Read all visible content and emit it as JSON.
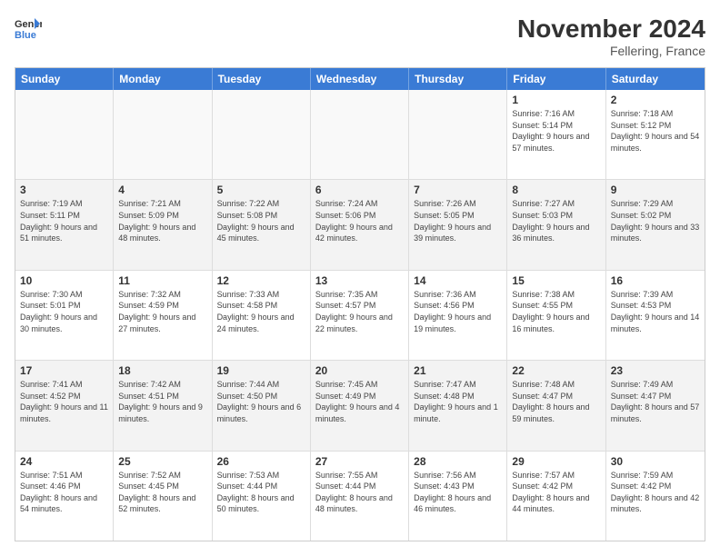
{
  "logo": {
    "line1": "General",
    "line2": "Blue"
  },
  "title": "November 2024",
  "location": "Fellering, France",
  "header_days": [
    "Sunday",
    "Monday",
    "Tuesday",
    "Wednesday",
    "Thursday",
    "Friday",
    "Saturday"
  ],
  "weeks": [
    {
      "alt": false,
      "days": [
        {
          "num": "",
          "info": ""
        },
        {
          "num": "",
          "info": ""
        },
        {
          "num": "",
          "info": ""
        },
        {
          "num": "",
          "info": ""
        },
        {
          "num": "",
          "info": ""
        },
        {
          "num": "1",
          "info": "Sunrise: 7:16 AM\nSunset: 5:14 PM\nDaylight: 9 hours and 57 minutes."
        },
        {
          "num": "2",
          "info": "Sunrise: 7:18 AM\nSunset: 5:12 PM\nDaylight: 9 hours and 54 minutes."
        }
      ]
    },
    {
      "alt": true,
      "days": [
        {
          "num": "3",
          "info": "Sunrise: 7:19 AM\nSunset: 5:11 PM\nDaylight: 9 hours and 51 minutes."
        },
        {
          "num": "4",
          "info": "Sunrise: 7:21 AM\nSunset: 5:09 PM\nDaylight: 9 hours and 48 minutes."
        },
        {
          "num": "5",
          "info": "Sunrise: 7:22 AM\nSunset: 5:08 PM\nDaylight: 9 hours and 45 minutes."
        },
        {
          "num": "6",
          "info": "Sunrise: 7:24 AM\nSunset: 5:06 PM\nDaylight: 9 hours and 42 minutes."
        },
        {
          "num": "7",
          "info": "Sunrise: 7:26 AM\nSunset: 5:05 PM\nDaylight: 9 hours and 39 minutes."
        },
        {
          "num": "8",
          "info": "Sunrise: 7:27 AM\nSunset: 5:03 PM\nDaylight: 9 hours and 36 minutes."
        },
        {
          "num": "9",
          "info": "Sunrise: 7:29 AM\nSunset: 5:02 PM\nDaylight: 9 hours and 33 minutes."
        }
      ]
    },
    {
      "alt": false,
      "days": [
        {
          "num": "10",
          "info": "Sunrise: 7:30 AM\nSunset: 5:01 PM\nDaylight: 9 hours and 30 minutes."
        },
        {
          "num": "11",
          "info": "Sunrise: 7:32 AM\nSunset: 4:59 PM\nDaylight: 9 hours and 27 minutes."
        },
        {
          "num": "12",
          "info": "Sunrise: 7:33 AM\nSunset: 4:58 PM\nDaylight: 9 hours and 24 minutes."
        },
        {
          "num": "13",
          "info": "Sunrise: 7:35 AM\nSunset: 4:57 PM\nDaylight: 9 hours and 22 minutes."
        },
        {
          "num": "14",
          "info": "Sunrise: 7:36 AM\nSunset: 4:56 PM\nDaylight: 9 hours and 19 minutes."
        },
        {
          "num": "15",
          "info": "Sunrise: 7:38 AM\nSunset: 4:55 PM\nDaylight: 9 hours and 16 minutes."
        },
        {
          "num": "16",
          "info": "Sunrise: 7:39 AM\nSunset: 4:53 PM\nDaylight: 9 hours and 14 minutes."
        }
      ]
    },
    {
      "alt": true,
      "days": [
        {
          "num": "17",
          "info": "Sunrise: 7:41 AM\nSunset: 4:52 PM\nDaylight: 9 hours and 11 minutes."
        },
        {
          "num": "18",
          "info": "Sunrise: 7:42 AM\nSunset: 4:51 PM\nDaylight: 9 hours and 9 minutes."
        },
        {
          "num": "19",
          "info": "Sunrise: 7:44 AM\nSunset: 4:50 PM\nDaylight: 9 hours and 6 minutes."
        },
        {
          "num": "20",
          "info": "Sunrise: 7:45 AM\nSunset: 4:49 PM\nDaylight: 9 hours and 4 minutes."
        },
        {
          "num": "21",
          "info": "Sunrise: 7:47 AM\nSunset: 4:48 PM\nDaylight: 9 hours and 1 minute."
        },
        {
          "num": "22",
          "info": "Sunrise: 7:48 AM\nSunset: 4:47 PM\nDaylight: 8 hours and 59 minutes."
        },
        {
          "num": "23",
          "info": "Sunrise: 7:49 AM\nSunset: 4:47 PM\nDaylight: 8 hours and 57 minutes."
        }
      ]
    },
    {
      "alt": false,
      "days": [
        {
          "num": "24",
          "info": "Sunrise: 7:51 AM\nSunset: 4:46 PM\nDaylight: 8 hours and 54 minutes."
        },
        {
          "num": "25",
          "info": "Sunrise: 7:52 AM\nSunset: 4:45 PM\nDaylight: 8 hours and 52 minutes."
        },
        {
          "num": "26",
          "info": "Sunrise: 7:53 AM\nSunset: 4:44 PM\nDaylight: 8 hours and 50 minutes."
        },
        {
          "num": "27",
          "info": "Sunrise: 7:55 AM\nSunset: 4:44 PM\nDaylight: 8 hours and 48 minutes."
        },
        {
          "num": "28",
          "info": "Sunrise: 7:56 AM\nSunset: 4:43 PM\nDaylight: 8 hours and 46 minutes."
        },
        {
          "num": "29",
          "info": "Sunrise: 7:57 AM\nSunset: 4:42 PM\nDaylight: 8 hours and 44 minutes."
        },
        {
          "num": "30",
          "info": "Sunrise: 7:59 AM\nSunset: 4:42 PM\nDaylight: 8 hours and 42 minutes."
        }
      ]
    }
  ]
}
